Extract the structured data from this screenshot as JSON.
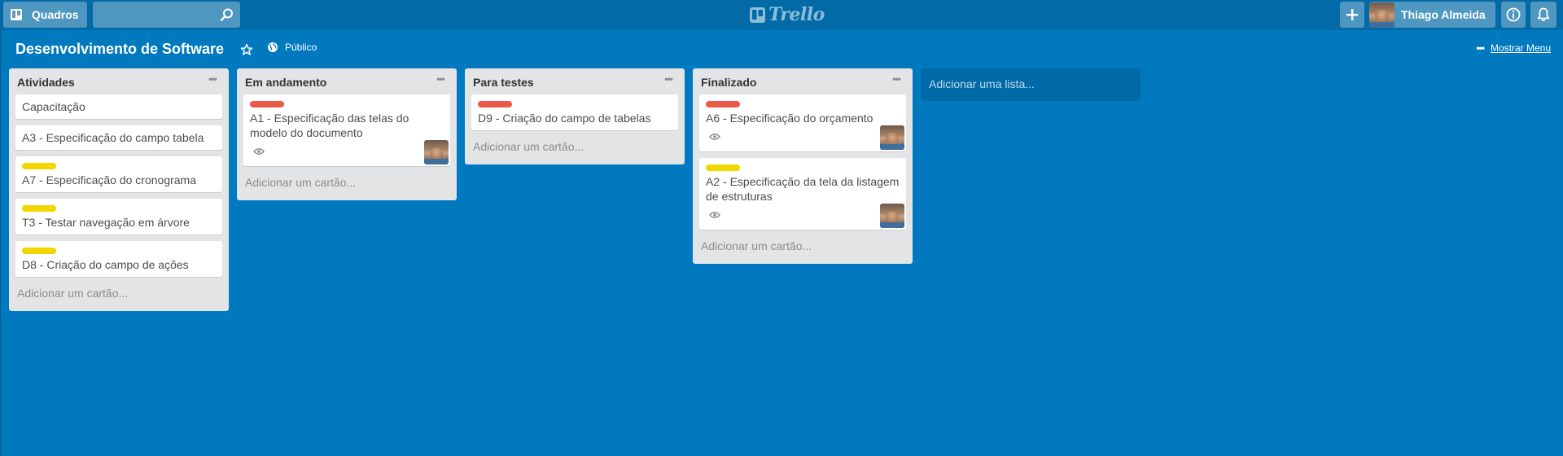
{
  "header": {
    "boards_label": "Quadros",
    "search_value": "",
    "logo_text": "Trello",
    "user_name": "Thiago Almeida"
  },
  "board": {
    "title": "Desenvolvimento de Software",
    "visibility": "Público",
    "menu_label": "Mostrar Menu"
  },
  "lists": [
    {
      "title": "Atividades",
      "add_card": "Adicionar um cartão...",
      "cards": [
        {
          "title": "Capacitação",
          "label": null
        },
        {
          "title": "A3 - Especificação do campo tabela",
          "label": null
        },
        {
          "title": "A7 - Especificação do cronograma",
          "label": "yellow"
        },
        {
          "title": "T3 - Testar navegação em árvore",
          "label": "yellow"
        },
        {
          "title": "D8 - Criação do campo de ações",
          "label": "yellow"
        }
      ]
    },
    {
      "title": "Em andamento",
      "add_card": "Adicionar um cartão...",
      "cards": [
        {
          "title": "A1 - Especificação das telas do modelo do documento",
          "label": "red",
          "watching": true,
          "member": true
        }
      ]
    },
    {
      "title": "Para testes",
      "add_card": "Adicionar um cartão...",
      "cards": [
        {
          "title": "D9 - Criação do campo de tabelas",
          "label": "red"
        }
      ]
    },
    {
      "title": "Finalizado",
      "add_card": "Adicionar um cartão...",
      "cards": [
        {
          "title": "A6 - Especificação do orçamento",
          "label": "red",
          "watching": true,
          "member": true
        },
        {
          "title": "A2 - Especificação da tela da listagem de estruturas",
          "label": "yellow",
          "watching": true,
          "member": true
        }
      ]
    }
  ],
  "add_list_label": "Adicionar uma lista...",
  "colors": {
    "background": "#0079bf",
    "header": "#026aa7",
    "label_red": "#eb5a46",
    "label_yellow": "#f2d600"
  },
  "icons": [
    "boards-icon",
    "search-icon",
    "trello-logo-icon",
    "plus-icon",
    "info-icon",
    "bell-icon",
    "star-icon",
    "globe-icon",
    "ellipsis-icon",
    "eye-icon"
  ]
}
